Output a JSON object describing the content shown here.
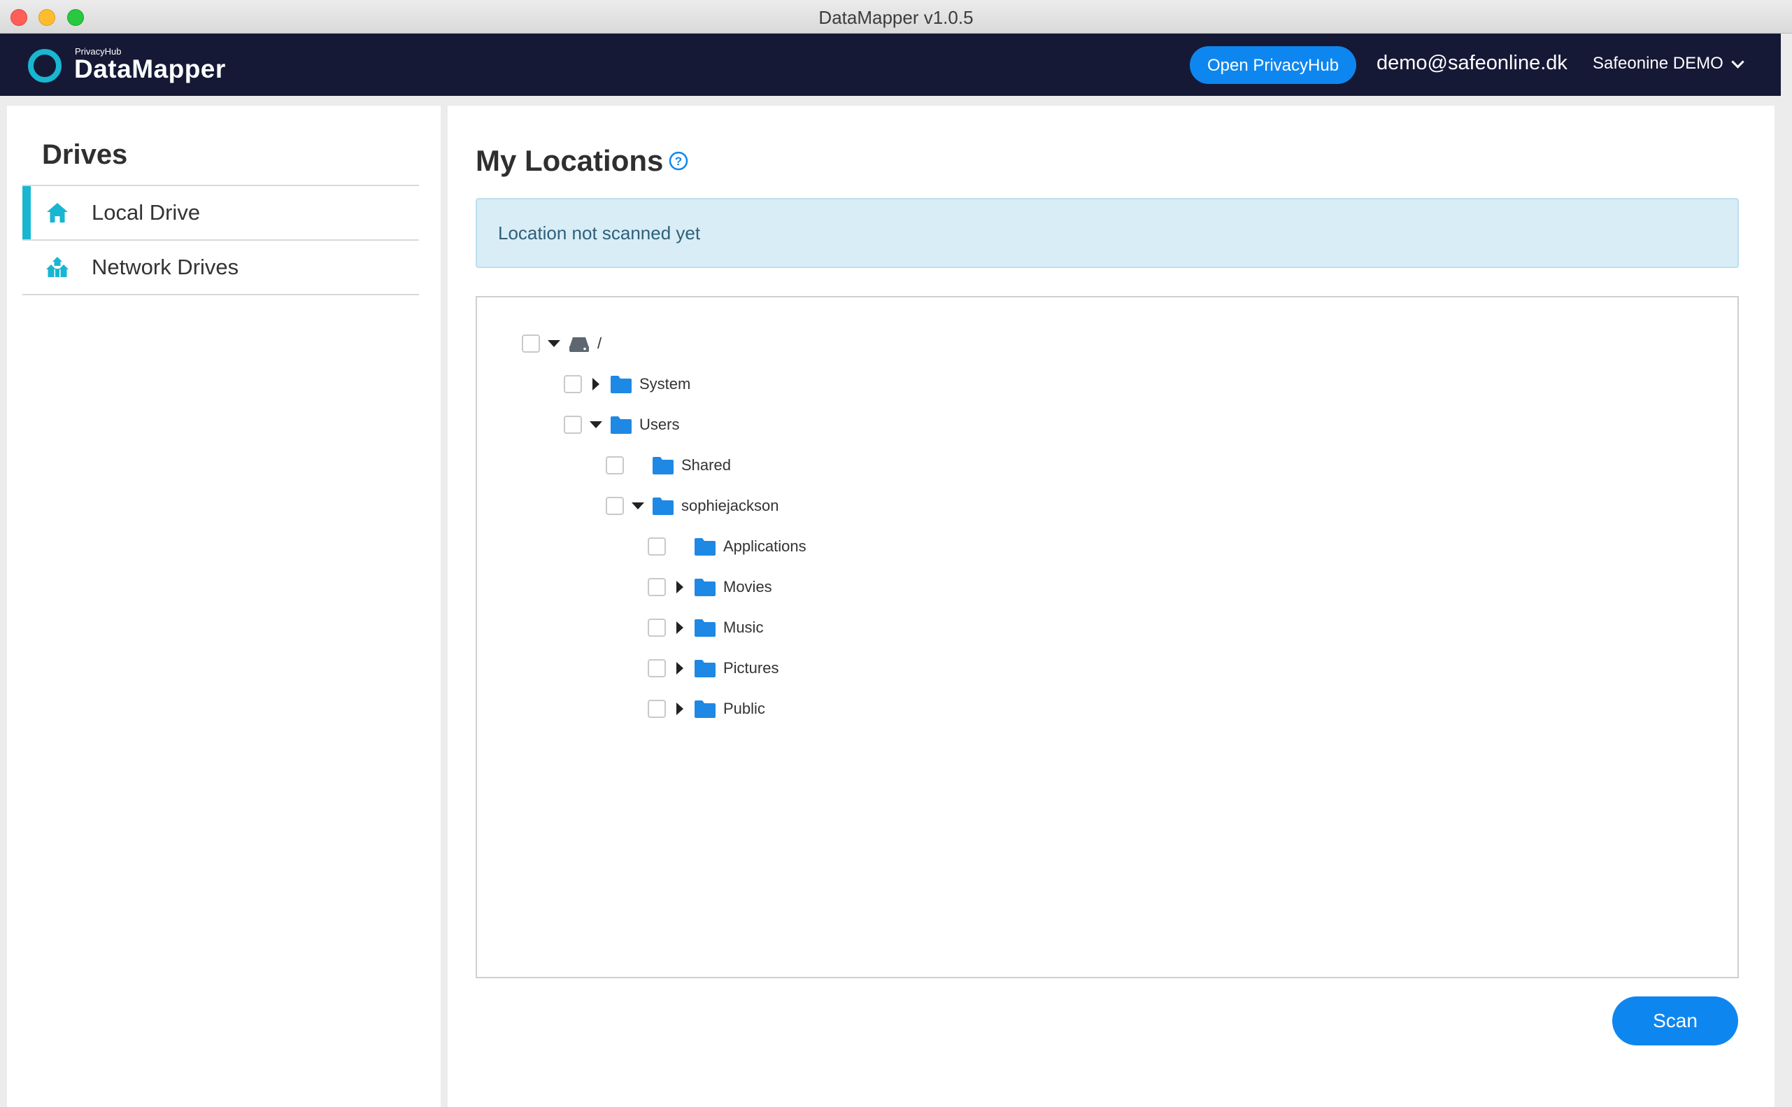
{
  "window": {
    "title": "DataMapper v1.0.5"
  },
  "header": {
    "brand_small": "PrivacyHub",
    "brand_name": "DataMapper",
    "open_button": "Open PrivacyHub",
    "user_email": "demo@safeonline.dk",
    "organization": "Safeonine DEMO"
  },
  "sidebar": {
    "title": "Drives",
    "items": [
      {
        "label": "Local Drive",
        "icon": "home-icon",
        "active": true
      },
      {
        "label": "Network Drives",
        "icon": "network-icon",
        "active": false
      }
    ]
  },
  "main": {
    "title": "My Locations",
    "help_icon": "question-circle-icon",
    "alert": "Location not scanned yet",
    "tree": [
      {
        "label": "/",
        "type": "drive",
        "depth": 0,
        "state": "expanded"
      },
      {
        "label": "System",
        "type": "folder",
        "depth": 1,
        "state": "collapsed"
      },
      {
        "label": "Users",
        "type": "folder",
        "depth": 1,
        "state": "expanded"
      },
      {
        "label": "Shared",
        "type": "folder",
        "depth": 2,
        "state": "leaf"
      },
      {
        "label": "sophiejackson",
        "type": "folder",
        "depth": 2,
        "state": "expanded"
      },
      {
        "label": "Applications",
        "type": "folder",
        "depth": 3,
        "state": "leaf"
      },
      {
        "label": "Movies",
        "type": "folder",
        "depth": 3,
        "state": "collapsed"
      },
      {
        "label": "Music",
        "type": "folder",
        "depth": 3,
        "state": "collapsed"
      },
      {
        "label": "Pictures",
        "type": "folder",
        "depth": 3,
        "state": "collapsed"
      },
      {
        "label": "Public",
        "type": "folder",
        "depth": 3,
        "state": "collapsed"
      }
    ],
    "scan_button": "Scan"
  },
  "colors": {
    "header_bg": "#151936",
    "accent_cyan": "#19b6d2",
    "primary_blue": "#0e86ef",
    "alert_bg": "#d9edf6",
    "folder_blue": "#1e88e5"
  }
}
